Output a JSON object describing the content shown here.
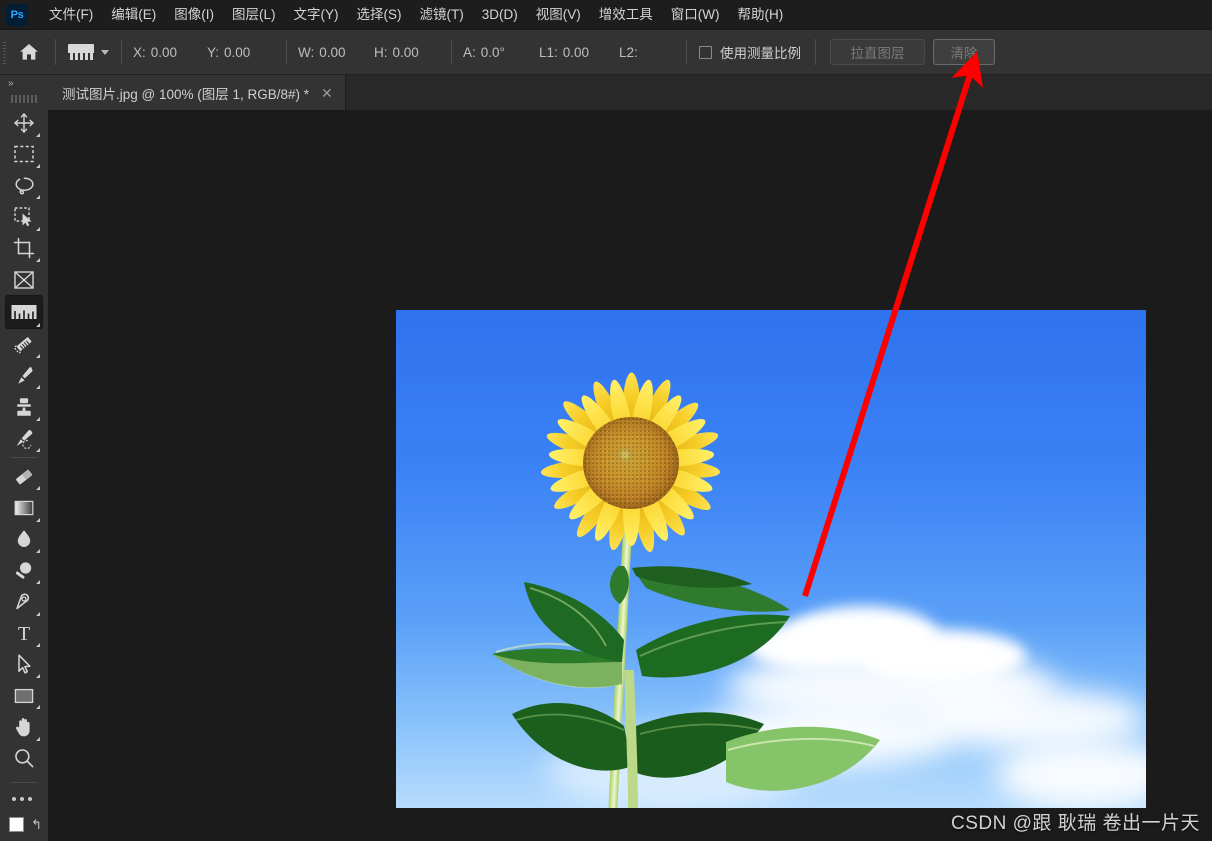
{
  "app": {
    "logo_text": "Ps",
    "logo_name": "photoshop-logo"
  },
  "menubar": {
    "items": [
      {
        "label": "文件(F)",
        "name": "menu-file"
      },
      {
        "label": "编辑(E)",
        "name": "menu-edit"
      },
      {
        "label": "图像(I)",
        "name": "menu-image"
      },
      {
        "label": "图层(L)",
        "name": "menu-layer"
      },
      {
        "label": "文字(Y)",
        "name": "menu-type"
      },
      {
        "label": "选择(S)",
        "name": "menu-select"
      },
      {
        "label": "滤镜(T)",
        "name": "menu-filter"
      },
      {
        "label": "3D(D)",
        "name": "menu-3d"
      },
      {
        "label": "视图(V)",
        "name": "menu-view"
      },
      {
        "label": "增效工具",
        "name": "menu-plugins"
      },
      {
        "label": "窗口(W)",
        "name": "menu-window"
      },
      {
        "label": "帮助(H)",
        "name": "menu-help"
      }
    ]
  },
  "options_bar": {
    "home_icon": "home-icon",
    "tool_preset_icon": "ruler-tool-icon",
    "fields": [
      {
        "label": "X:",
        "value": "0.00",
        "name": "measure-x"
      },
      {
        "label": "Y:",
        "value": "0.00",
        "name": "measure-y"
      },
      {
        "label": "W:",
        "value": "0.00",
        "name": "measure-w"
      },
      {
        "label": "H:",
        "value": "0.00",
        "name": "measure-h"
      },
      {
        "label": "A:",
        "value": "0.0°",
        "name": "measure-angle"
      },
      {
        "label": "L1:",
        "value": "0.00",
        "name": "measure-l1"
      },
      {
        "label": "L2:",
        "value": "",
        "name": "measure-l2"
      }
    ],
    "use_measurement_scale_label": "使用测量比例",
    "use_measurement_scale_checked": false,
    "straighten_layer_label": "拉直图层",
    "clear_label": "清除"
  },
  "tabbar": {
    "document_tab": {
      "title": "测试图片.jpg @ 100% (图层 1, RGB/8#) *",
      "close_glyph": "✕"
    }
  },
  "toolbar": {
    "collapse_glyph": "»",
    "tools": [
      {
        "name": "move-tool",
        "icon": "move-icon",
        "active": false,
        "has_corner": true
      },
      {
        "name": "rectangular-marquee-tool",
        "icon": "marquee-icon",
        "active": false,
        "has_corner": true
      },
      {
        "name": "lasso-tool",
        "icon": "lasso-icon",
        "active": false,
        "has_corner": true
      },
      {
        "name": "quick-selection-tool",
        "icon": "quick-select-icon",
        "active": false,
        "has_corner": true
      },
      {
        "name": "crop-tool",
        "icon": "crop-icon",
        "active": false,
        "has_corner": true
      },
      {
        "name": "frame-tool",
        "icon": "frame-icon",
        "active": false,
        "has_corner": false
      },
      {
        "name": "ruler-tool",
        "icon": "ruler-icon",
        "active": true,
        "has_corner": true
      },
      {
        "name": "spot-healing-brush-tool",
        "icon": "healing-brush-icon",
        "active": false,
        "has_corner": true
      },
      {
        "name": "brush-tool",
        "icon": "brush-icon",
        "active": false,
        "has_corner": true
      },
      {
        "name": "clone-stamp-tool",
        "icon": "clone-stamp-icon",
        "active": false,
        "has_corner": true
      },
      {
        "name": "history-brush-tool",
        "icon": "history-brush-icon",
        "active": false,
        "has_corner": true
      },
      {
        "name": "eraser-tool",
        "icon": "eraser-icon",
        "active": false,
        "has_corner": true
      },
      {
        "name": "gradient-tool",
        "icon": "gradient-icon",
        "active": false,
        "has_corner": true
      },
      {
        "name": "blur-tool",
        "icon": "blur-droplet-icon",
        "active": false,
        "has_corner": true
      },
      {
        "name": "dodge-tool",
        "icon": "dodge-icon",
        "active": false,
        "has_corner": true
      },
      {
        "name": "pen-tool",
        "icon": "pen-icon",
        "active": false,
        "has_corner": true
      },
      {
        "name": "type-tool",
        "icon": "type-t-icon",
        "active": false,
        "has_corner": true
      },
      {
        "name": "path-selection-tool",
        "icon": "path-arrow-icon",
        "active": false,
        "has_corner": true
      },
      {
        "name": "rectangle-tool",
        "icon": "rectangle-icon",
        "active": false,
        "has_corner": true
      },
      {
        "name": "hand-tool",
        "icon": "hand-icon",
        "active": false,
        "has_corner": true
      },
      {
        "name": "zoom-tool",
        "icon": "magnifier-icon",
        "active": false,
        "has_corner": false
      }
    ],
    "edit_toolbar_icon": "ellipsis-icon",
    "foreground_color": "#ffffff",
    "background_color": "#1a1a1a",
    "swap_glyph": "↰"
  },
  "canvas": {
    "document_name": "测试图片.jpg",
    "zoom_level": "100%",
    "image_alt": "sunflower-photo",
    "photo": {
      "subject": "sunflower",
      "sky_color": "#3b82f6",
      "petal_color": "#fcdc3c",
      "disc_color": "#c08427",
      "leaf_color": "#1e6b24"
    }
  },
  "annotation": {
    "arrow_color": "#fe0000",
    "arrow_name": "red-pointer-arrow",
    "points_to": "清除"
  },
  "watermark": {
    "text": "CSDN @跟 耿瑞 卷出一片天"
  }
}
